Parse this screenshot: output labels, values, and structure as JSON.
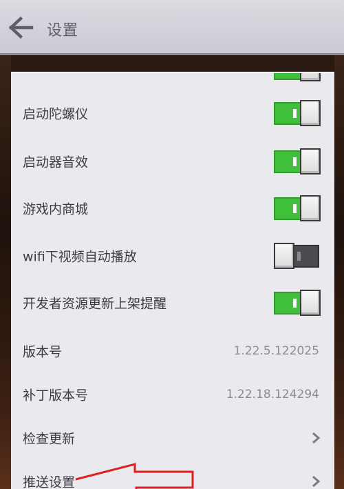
{
  "header": {
    "back_icon": "arrow-left-icon",
    "title": "设置"
  },
  "settings": [
    {
      "label": "启动陀螺仪",
      "type": "toggle",
      "state": "on"
    },
    {
      "label": "启动器音效",
      "type": "toggle",
      "state": "on"
    },
    {
      "label": "游戏内商城",
      "type": "toggle",
      "state": "on"
    },
    {
      "label": "wifi下视频自动播放",
      "type": "toggle",
      "state": "off"
    },
    {
      "label": "开发者资源更新上架提醒",
      "type": "toggle",
      "state": "on"
    },
    {
      "label": "版本号",
      "type": "value",
      "value": "1.22.5.122025"
    },
    {
      "label": "补丁版本号",
      "type": "value",
      "value": "1.22.18.124294"
    },
    {
      "label": "检查更新",
      "type": "link",
      "icon": "chevron-right-icon"
    },
    {
      "label": "推送设置",
      "type": "link",
      "icon": "chevron-right-icon"
    }
  ],
  "colors": {
    "toggle_on": "#3fbf3a",
    "toggle_off": "#4a4a4f",
    "annotation_arrow": "#e02020"
  }
}
